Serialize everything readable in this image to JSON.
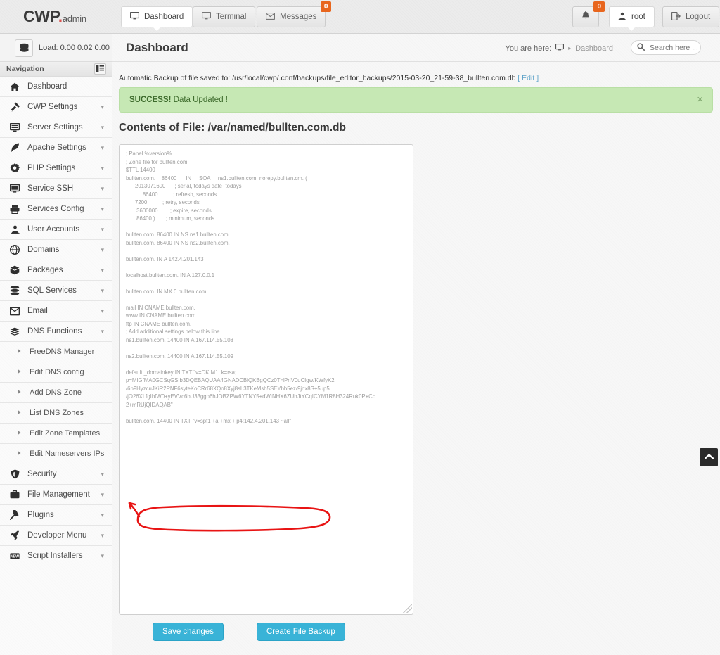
{
  "brand": {
    "name": "CWP",
    "dot": ".",
    "suffix": "admin"
  },
  "topnav": {
    "tabs": [
      {
        "label": "Dashboard",
        "icon": "monitor-icon",
        "active": true
      },
      {
        "label": "Terminal",
        "icon": "monitor-icon",
        "active": false
      },
      {
        "label": "Messages",
        "icon": "envelope-icon",
        "active": false,
        "badge": "0"
      }
    ],
    "bell": {
      "icon": "bell-icon",
      "badge": "0"
    },
    "user": {
      "label": "root",
      "icon": "user-icon"
    },
    "logout": {
      "label": "Logout",
      "icon": "logout-icon"
    }
  },
  "loadbar": {
    "icon": "database-icon",
    "label": "Load: 0.00  0.02  0.00"
  },
  "pagehead": {
    "title": "Dashboard",
    "breadcrumb_prefix": "You are here:",
    "breadcrumb_icon": "monitor-icon",
    "breadcrumb_sep": "▸",
    "breadcrumb_current": "Dashboard",
    "search_placeholder": "Search here ...",
    "search_value": "",
    "search_icon": "search-icon"
  },
  "sidebar": {
    "header": "Navigation",
    "toggle_icon": "panel-toggle-icon",
    "items": [
      {
        "label": "Dashboard",
        "icon": "home-icon",
        "caret": false,
        "sub": false
      },
      {
        "label": "CWP Settings",
        "icon": "tools-icon",
        "caret": true,
        "sub": false
      },
      {
        "label": "Server Settings",
        "icon": "server-icon",
        "caret": true,
        "sub": false
      },
      {
        "label": "Apache Settings",
        "icon": "feather-icon",
        "caret": true,
        "sub": false
      },
      {
        "label": "PHP Settings",
        "icon": "gear-icon",
        "caret": true,
        "sub": false
      },
      {
        "label": "Service SSH",
        "icon": "monitor-icon",
        "caret": true,
        "sub": false
      },
      {
        "label": "Services Config",
        "icon": "printer-icon",
        "caret": true,
        "sub": false
      },
      {
        "label": "User Accounts",
        "icon": "user-icon",
        "caret": true,
        "sub": false
      },
      {
        "label": "Domains",
        "icon": "globe-icon",
        "caret": true,
        "sub": false
      },
      {
        "label": "Packages",
        "icon": "box-icon",
        "caret": true,
        "sub": false
      },
      {
        "label": "SQL Services",
        "icon": "database-icon",
        "caret": true,
        "sub": false
      },
      {
        "label": "Email",
        "icon": "envelope-icon",
        "caret": true,
        "sub": false
      },
      {
        "label": "DNS Functions",
        "icon": "layers-icon",
        "caret": true,
        "sub": false
      },
      {
        "label": "FreeDNS Manager",
        "icon": "bullet-icon",
        "caret": false,
        "sub": true
      },
      {
        "label": "Edit DNS config",
        "icon": "bullet-icon",
        "caret": false,
        "sub": true
      },
      {
        "label": "Add DNS Zone",
        "icon": "bullet-icon",
        "caret": false,
        "sub": true
      },
      {
        "label": "List DNS Zones",
        "icon": "bullet-icon",
        "caret": false,
        "sub": true
      },
      {
        "label": "Edit Zone Templates",
        "icon": "bullet-icon",
        "caret": false,
        "sub": true
      },
      {
        "label": "Edit Nameservers IPs",
        "icon": "bullet-icon",
        "caret": false,
        "sub": true
      },
      {
        "label": "Security",
        "icon": "shield-icon",
        "caret": true,
        "sub": false
      },
      {
        "label": "File Management",
        "icon": "briefcase-icon",
        "caret": true,
        "sub": false
      },
      {
        "label": "Plugins",
        "icon": "plug-icon",
        "caret": true,
        "sub": false
      },
      {
        "label": "Developer Menu",
        "icon": "hammer-icon",
        "caret": true,
        "sub": false
      },
      {
        "label": "Script Installers",
        "icon": "new-icon",
        "caret": true,
        "sub": false
      }
    ]
  },
  "content": {
    "backup_note": "Automatic Backup of file saved to: /usr/local/cwp/.conf/backups/file_editor_backups/2015-03-20_21-59-38_bullten.com.db",
    "backup_edit_link": "[ Edit ]",
    "alert": {
      "strong": "SUCCESS!",
      "text": " Data Updated !",
      "close_icon": "close-icon"
    },
    "file_title": "Contents of File: /var/named/bullten.com.db",
    "file_contents": "; Panel %version%\n; Zone file for bullten.com\n$TTL 14400\nbullten.com.    86400      IN     SOA     ns1.bullten.com. norepy.bullten.cm. (\n      2013071600      ; serial, todays date+todays\n           86400          ; refresh, seconds\n      7200          ; retry, seconds\n       3600000        ; expire, seconds\n       86400 )       ; minimum, seconds\n\nbullten.com. 86400 IN NS ns1.bullten.com.\nbullten.com. 86400 IN NS ns2.bullten.com.\n\nbullten.com. IN A 142.4.201.143\n\nlocalhost.bullten.com. IN A 127.0.0.1\n\nbullten.com. IN MX 0 bullten.com.\n\nmail IN CNAME bullten.com.\nwww IN CNAME bullten.com.\nftp IN CNAME bullten.com.\n; Add additional settings below this line\nns1.bullten.com. 14400 IN A 167.114.55.108\n\nns2.bullten.com. 14400 IN A 167.114.55.109\n\ndefault._domainkey IN TXT \"v=DKIM1; k=rsa;\np=MIGfMA0GCSqGSIb3DQEBAQUAA4GNADCBiQKBgQCz0THPnV0uCIgw/KWfyK2\n/6b9HyzcuJKiR2PNF6syteKoCRr68XQo8Xyj8sL3TKeMsh5SEYhb5ez/9jnx8S+5up5\n/jO26XLfgIbfW0+yEVVc6bU33ggo6hJOBZPW6YTNY5+dWtNHX6ZUhJtYCqICYM1R8H324Ruk0P+Cb\n2+mRUjQIDAQAB\"\n\nbullten.com. 14400 IN TXT \"v=spf1 +a +mx +ip4:142.4.201.143 ~all\"",
    "buttons": {
      "save": "Save changes",
      "backup": "Create File Backup"
    },
    "scrolltop_icon": "chevron-up-icon",
    "annotation": {
      "type": "hand-drawn-ellipse-with-arrow",
      "color": "#e81414"
    }
  }
}
